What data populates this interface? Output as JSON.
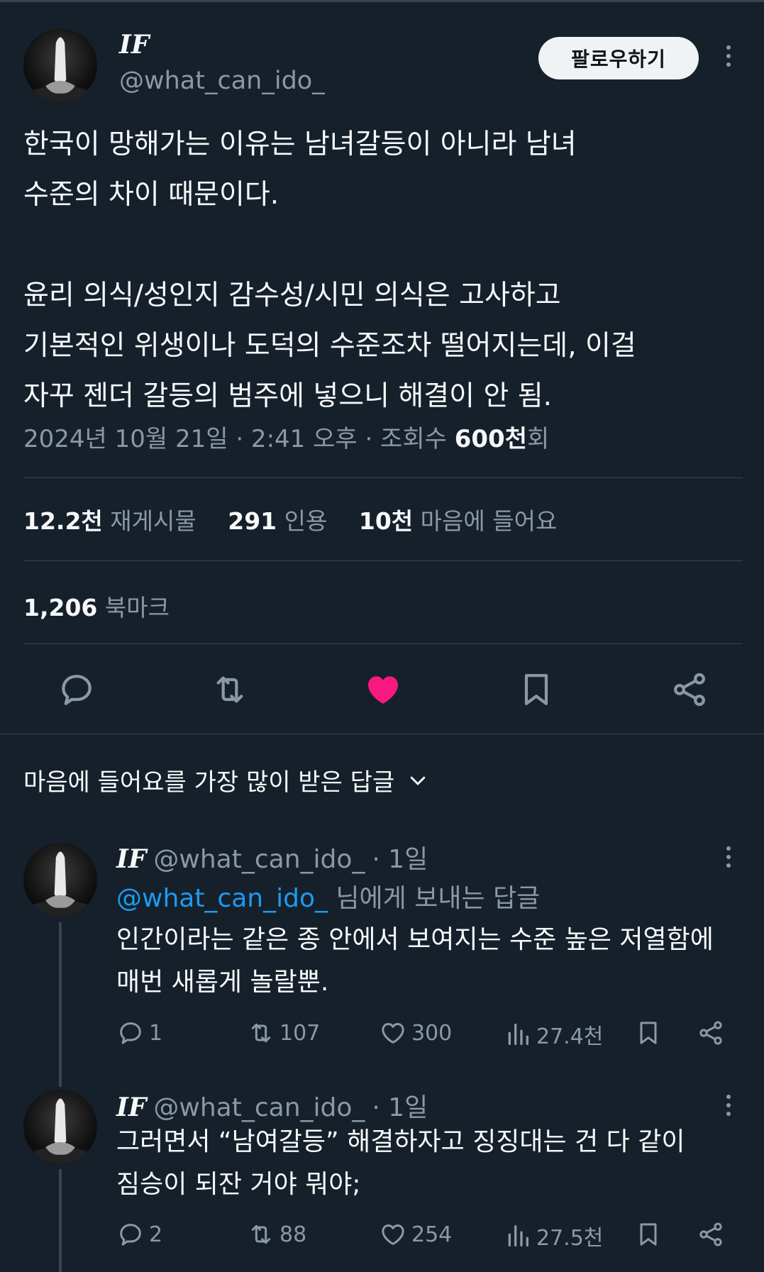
{
  "tweet": {
    "author_name": "IF",
    "author_handle": "@what_can_ido_",
    "follow_label": "팔로우하기",
    "text": "한국이 망해가는 이유는 남녀갈등이 아니라 남녀\n수준의 차이 때문이다.\n\n윤리 의식/성인지 감수성/시민 의식은 고사하고\n기본적인 위생이나 도덕의 수준조차 떨어지는데, 이걸\n자꾸 젠더 갈등의 범주에 넣으니 해결이 안 됨.",
    "date_time": "2024년 10월 21일 · 2:41 오후 · 조회수 ",
    "views_value": "600천",
    "views_suffix": "회",
    "retweets_count": "12.2천",
    "retweets_label": "재게시물",
    "quotes_count": "291",
    "quotes_label": "인용",
    "likes_count": "10천",
    "likes_label": "마음에 들어요",
    "bookmarks_count": "1,206",
    "bookmarks_label": "북마크",
    "like_color": "#f91880"
  },
  "replies_sort": {
    "label": "마음에 들어요를 가장 많이 받은 답글"
  },
  "replies": [
    {
      "author_name": "IF",
      "author_handle": "@what_can_ido_",
      "time": "· 1일",
      "replying_to_handle": "@what_can_ido_",
      "replying_to_suffix": " 님에게 보내는 답글",
      "text": "인간이라는 같은 종 안에서 보여지는 수준 높은 저열함에\n매번 새롭게 놀랄뿐.",
      "reply_count": "1",
      "retweet_count": "107",
      "like_count": "300",
      "view_count": "27.4천"
    },
    {
      "author_name": "IF",
      "author_handle": "@what_can_ido_",
      "time": "· 1일",
      "text": "그러면서 “남여갈등” 해결하자고 징징대는 건 다 같이\n짐승이 되잔 거야 뭐야;",
      "reply_count": "2",
      "retweet_count": "88",
      "like_count": "254",
      "view_count": "27.5천"
    }
  ],
  "colors": {
    "background": "#15202b",
    "text": "#f7f9f9",
    "secondary": "#8b98a5",
    "accent": "#1d9bf0",
    "divider": "#38444d"
  }
}
